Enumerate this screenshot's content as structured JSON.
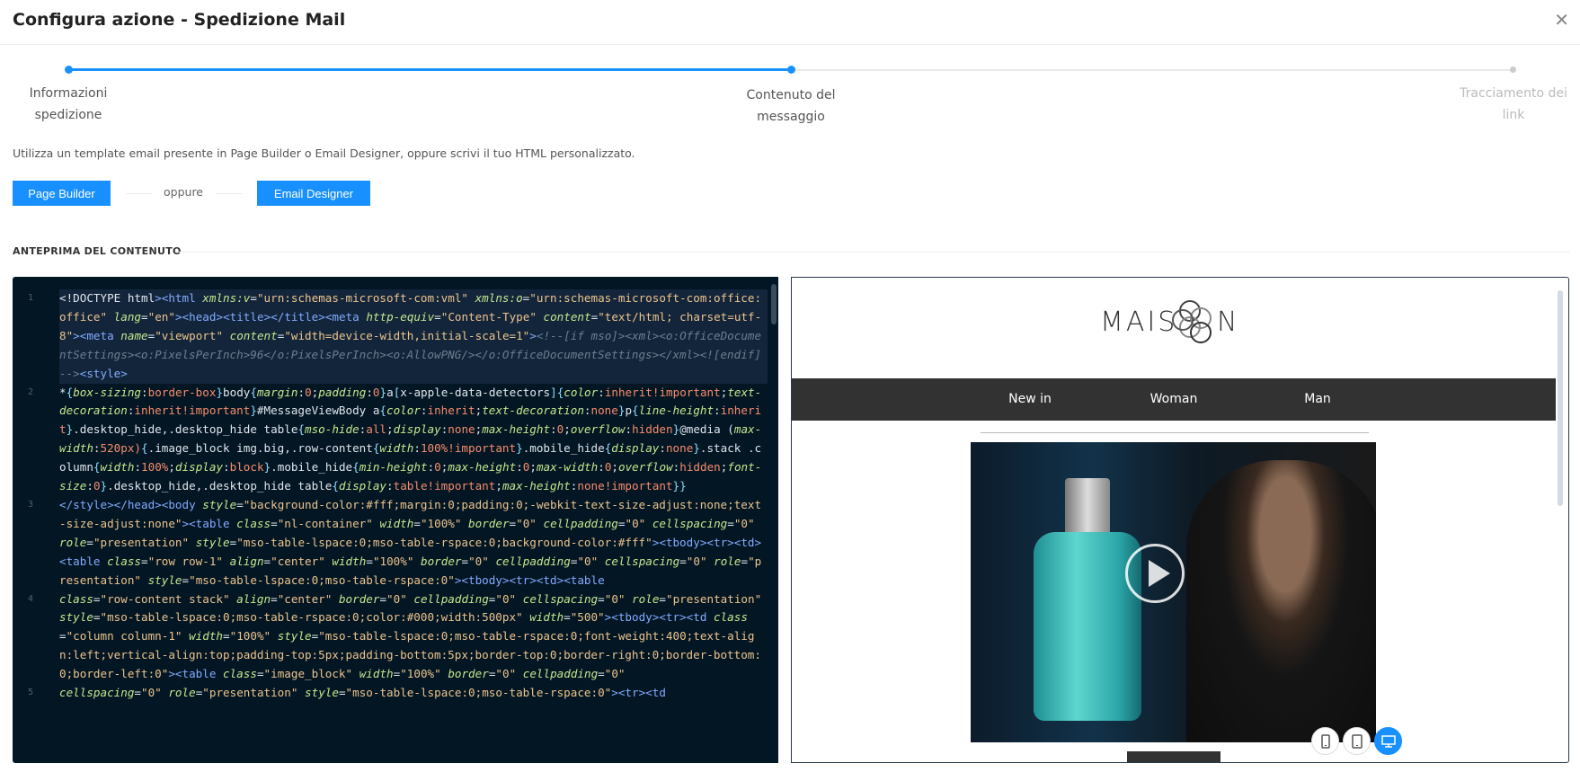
{
  "header": {
    "title": "Configura azione - Spedizione Mail",
    "close_icon": "close-icon"
  },
  "stepper": {
    "steps": [
      {
        "label": "Informazioni\nspedizione",
        "state": "done"
      },
      {
        "label": "Contenuto del\nmessaggio",
        "state": "active"
      },
      {
        "label": "Tracciamento dei\nlink",
        "state": "pending"
      }
    ],
    "colors": {
      "active": "#1890ff",
      "pending": "#e8e8e8"
    }
  },
  "description": "Utilizza un template email presente in Page Builder o Email Designer, oppure scrivi il tuo HTML personalizzato.",
  "actions": {
    "page_builder": "Page Builder",
    "separator": "oppure",
    "email_designer": "Email Designer"
  },
  "section_title": "ANTEPRIMA DEL CONTENUTO",
  "editor": {
    "lines": [
      {
        "n": "1",
        "code": "<!DOCTYPE html><html xmlns:v=\"urn:schemas-microsoft-com:vml\" xmlns:o=\"urn:schemas-microsoft-com:office:office\" lang=\"en\"><head><title></title><meta http-equiv=\"Content-Type\" content=\"text/html; charset=utf-8\"><meta name=\"viewport\" content=\"width=device-width,initial-scale=1\"><!--[if mso]><xml><o:OfficeDocumentSettings><o:PixelsPerInch>96</o:PixelsPerInch><o:AllowPNG/></o:OfficeDocumentSettings></xml><![endif]--><style>"
      },
      {
        "n": "2",
        "code": "*{box-sizing:border-box}body{margin:0;padding:0}a[x-apple-data-detectors]{color:inherit!important;text-decoration:inherit!important}#MessageViewBody a{color:inherit;text-decoration:none}p{line-height:inherit}.desktop_hide,.desktop_hide table{mso-hide:all;display:none;max-height:0;overflow:hidden}@media (max-width:520px){.image_block img.big,.row-content{width:100%!important}.mobile_hide{display:none}.stack .column{width:100%;display:block}.mobile_hide{min-height:0;max-height:0;max-width:0;overflow:hidden;font-size:0}.desktop_hide,.desktop_hide table{display:table!important;max-height:none!important}}"
      },
      {
        "n": "3",
        "code": "</style></head><body style=\"background-color:#fff;margin:0;padding:0;-webkit-text-size-adjust:none;text-size-adjust:none\"><table class=\"nl-container\" width=\"100%\" border=\"0\" cellpadding=\"0\" cellspacing=\"0\" role=\"presentation\" style=\"mso-table-lspace:0;mso-table-rspace:0;background-color:#fff\"><tbody><tr><td><table class=\"row row-1\" align=\"center\" width=\"100%\" border=\"0\" cellpadding=\"0\" cellspacing=\"0\" role=\"presentation\" style=\"mso-table-lspace:0;mso-table-rspace:0\"><tbody><tr><td><table"
      },
      {
        "n": "4",
        "code": "class=\"row-content stack\" align=\"center\" border=\"0\" cellpadding=\"0\" cellspacing=\"0\" role=\"presentation\" style=\"mso-table-lspace:0;mso-table-rspace:0;color:#000;width:500px\" width=\"500\"><tbody><tr><td class=\"column column-1\" width=\"100%\" style=\"mso-table-lspace:0;mso-table-rspace:0;font-weight:400;text-align:left;vertical-align:top;padding-top:5px;padding-bottom:5px;border-top:0;border-right:0;border-bottom:0;border-left:0\"><table class=\"image_block\" width=\"100%\" border=\"0\" cellpadding=\"0\""
      },
      {
        "n": "5",
        "code": "cellspacing=\"0\" role=\"presentation\" style=\"mso-table-lspace:0;mso-table-rspace:0\"><tr><td"
      }
    ]
  },
  "preview": {
    "logo": "MAISON",
    "nav": [
      "New in",
      "Woman",
      "Man"
    ],
    "play_icon": "play-icon",
    "devices": [
      {
        "name": "mobile-icon",
        "active": false
      },
      {
        "name": "tablet-icon",
        "active": false
      },
      {
        "name": "desktop-icon",
        "active": true
      }
    ]
  }
}
